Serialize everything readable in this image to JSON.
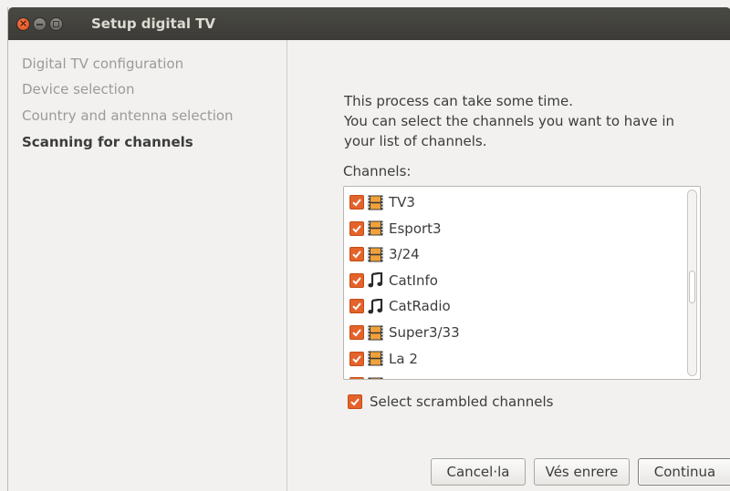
{
  "window": {
    "title": "Setup digital TV"
  },
  "sidebar": {
    "steps": [
      {
        "label": "Digital TV configuration"
      },
      {
        "label": "Device selection"
      },
      {
        "label": "Country and antenna selection"
      },
      {
        "label": "Scanning for channels"
      }
    ]
  },
  "main": {
    "description": [
      "This process can take some time.",
      "You can select the channels you want to have in",
      "your list of channels."
    ],
    "channels_label": "Channels:",
    "channels": [
      {
        "name": "TV3",
        "type": "tv-icon",
        "checked": true
      },
      {
        "name": "Esport3",
        "type": "tv-icon",
        "checked": true
      },
      {
        "name": "3/24",
        "type": "tv-icon",
        "checked": true
      },
      {
        "name": "CatInfo",
        "type": "music-note-icon",
        "checked": true
      },
      {
        "name": "CatRadio",
        "type": "music-note-icon",
        "checked": true
      },
      {
        "name": "Super3/33",
        "type": "tv-icon",
        "checked": true
      },
      {
        "name": "La 2",
        "type": "tv-icon",
        "checked": true
      },
      {
        "name": "",
        "type": "tv-icon",
        "checked": true
      }
    ],
    "scrambled": {
      "label": "Select scrambled channels",
      "checked": true
    }
  },
  "buttons": {
    "cancel": "Cancel·la",
    "back": "Vés enrere",
    "next": "Continua"
  },
  "colors": {
    "accent": "#e4632a",
    "titlebar": "#3c3b37",
    "title_text": "#dfdbd2",
    "inactive_step": "#9c9a96"
  }
}
